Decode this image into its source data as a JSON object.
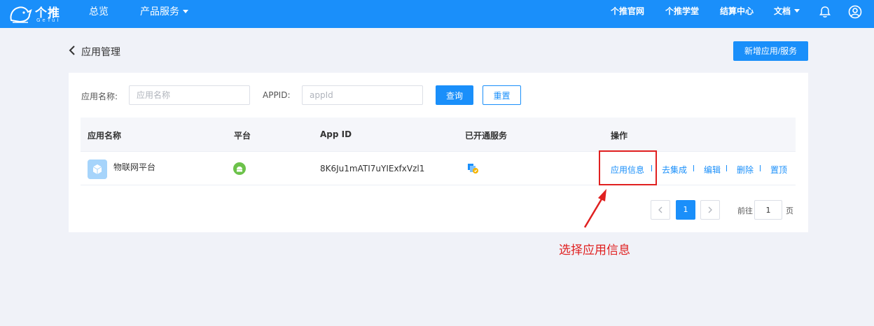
{
  "brand": {
    "name": "个推",
    "sub": "GeTuI"
  },
  "nav": {
    "overview": "总览",
    "products": "产品服务",
    "official": "个推官网",
    "academy": "个推学堂",
    "billing": "结算中心",
    "docs": "文档"
  },
  "page": {
    "title": "应用管理",
    "add_button": "新增应用/服务"
  },
  "filter": {
    "name_label": "应用名称:",
    "name_placeholder": "应用名称",
    "appid_label": "APPID:",
    "appid_placeholder": "appId",
    "query_button": "查询",
    "reset_button": "重置"
  },
  "table": {
    "columns": [
      "应用名称",
      "平台",
      "App ID",
      "已开通服务",
      "操作"
    ],
    "rows": [
      {
        "name": "物联网平台",
        "app_id": "8K6Ju1mATI7uYIExfxVzl1",
        "actions": [
          "应用信息",
          "去集成",
          "编辑",
          "删除",
          "置顶"
        ]
      }
    ]
  },
  "pagination": {
    "current": "1",
    "goto_label": "前往",
    "goto_value": "1",
    "page_unit": "页"
  },
  "annotation": {
    "text": "选择应用信息"
  },
  "colors": {
    "primary": "#1a8ffa",
    "annotation": "#e02020",
    "android": "#6cc24a"
  }
}
